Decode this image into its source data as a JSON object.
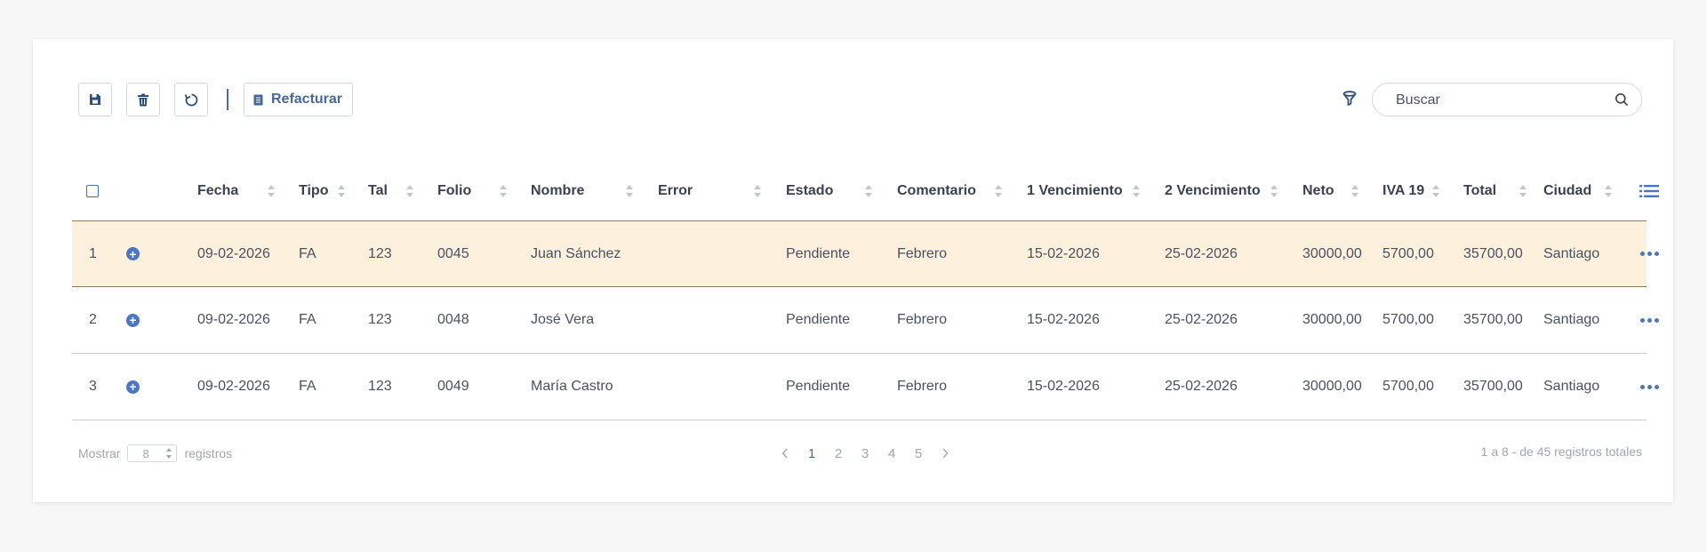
{
  "toolbar": {
    "save_icon": "save-icon",
    "delete_icon": "trash-icon",
    "refresh_icon": "refresh-icon",
    "refacturar_label": "Refacturar",
    "filter_icon": "filter-icon",
    "search_placeholder": "Buscar"
  },
  "table": {
    "columns": [
      "Fecha",
      "Tipo",
      "Tal",
      "Folio",
      "Nombre",
      "Error",
      "Estado",
      "Comentario",
      "1 Vencimiento",
      "2 Vencimiento",
      "Neto",
      "IVA 19",
      "Total",
      "Ciudad"
    ],
    "rows": [
      {
        "n": "1",
        "fecha": "09-02-2026",
        "tipo": "FA",
        "tal": "123",
        "folio": "0045",
        "nombre": "Juan Sánchez",
        "error": "",
        "estado": "Pendiente",
        "comentario": "Febrero",
        "venc1": "15-02-2026",
        "venc2": "25-02-2026",
        "neto": "30000,00",
        "iva": "5700,00",
        "total": "35700,00",
        "ciudad": "Santiago",
        "highlighted": true
      },
      {
        "n": "2",
        "fecha": "09-02-2026",
        "tipo": "FA",
        "tal": "123",
        "folio": "0048",
        "nombre": "José Vera",
        "error": "",
        "estado": "Pendiente",
        "comentario": "Febrero",
        "venc1": "15-02-2026",
        "venc2": "25-02-2026",
        "neto": "30000,00",
        "iva": "5700,00",
        "total": "35700,00",
        "ciudad": "Santiago",
        "highlighted": false
      },
      {
        "n": "3",
        "fecha": "09-02-2026",
        "tipo": "FA",
        "tal": "123",
        "folio": "0049",
        "nombre": "María Castro",
        "error": "",
        "estado": "Pendiente",
        "comentario": "Febrero",
        "venc1": "15-02-2026",
        "venc2": "25-02-2026",
        "neto": "30000,00",
        "iva": "5700,00",
        "total": "35700,00",
        "ciudad": "Santiago",
        "highlighted": false
      }
    ]
  },
  "footer": {
    "show_label": "Mostrar",
    "page_size": "8",
    "records_label": "registros",
    "pages": [
      "1",
      "2",
      "3",
      "4",
      "5"
    ],
    "current_page": "1",
    "summary": "1 a 8 - de 45 registros totales"
  },
  "colors": {
    "accent": "#4a6fa5",
    "highlight_row": "#fdf1de"
  }
}
